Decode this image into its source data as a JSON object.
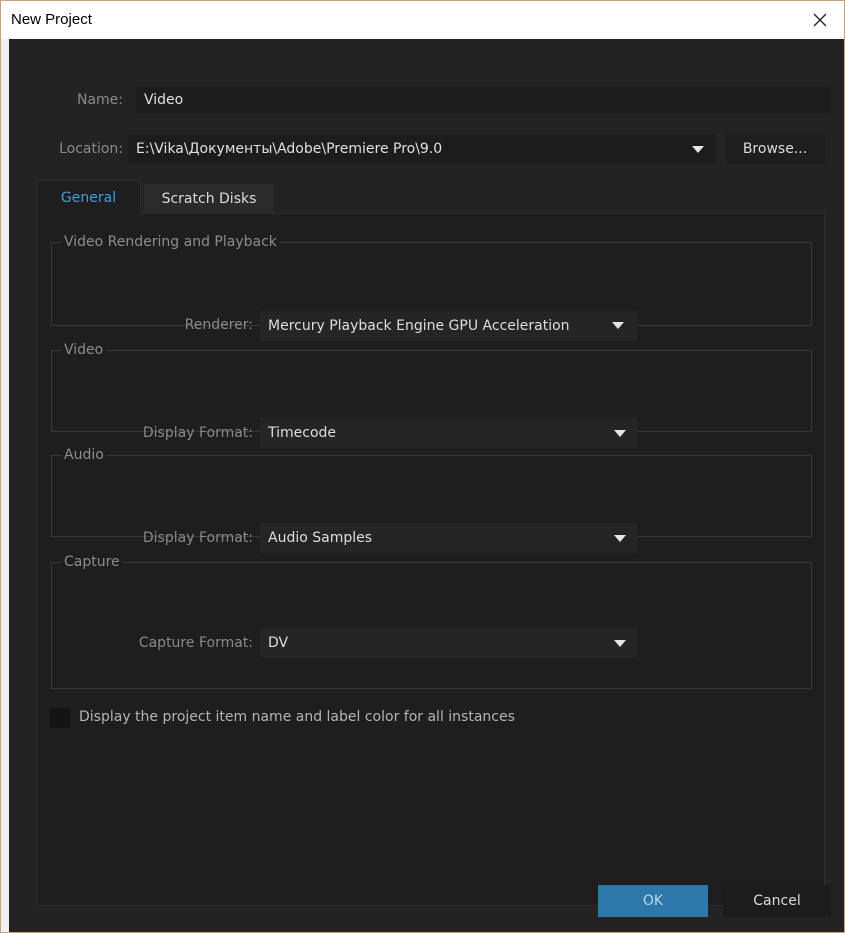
{
  "window": {
    "title": "New Project",
    "close_icon": "close-icon"
  },
  "name_field": {
    "label": "Name:",
    "value": "Video"
  },
  "location_field": {
    "label": "Location:",
    "value": "E:\\Vika\\Документы\\Adobe\\Premiere Pro\\9.0",
    "browse_label": "Browse..."
  },
  "tabs": [
    {
      "label": "General",
      "active": true
    },
    {
      "label": "Scratch Disks",
      "active": false
    }
  ],
  "groups": {
    "rendering": {
      "title": "Video Rendering and Playback",
      "renderer_label": "Renderer:",
      "renderer_value": "Mercury Playback Engine GPU Acceleration"
    },
    "video": {
      "title": "Video",
      "display_format_label": "Display Format:",
      "display_format_value": "Timecode"
    },
    "audio": {
      "title": "Audio",
      "display_format_label": "Display Format:",
      "display_format_value": "Audio Samples"
    },
    "capture": {
      "title": "Capture",
      "capture_format_label": "Capture Format:",
      "capture_format_value": "DV"
    }
  },
  "display_name_checkbox": {
    "label": "Display the project item name and label color for all instances",
    "checked": false
  },
  "buttons": {
    "ok": "OK",
    "cancel": "Cancel"
  },
  "colors": {
    "background": "#232323",
    "field": "#1c1c1c",
    "panel": "#1e1e1e",
    "accent_blue": "#2d77a9",
    "tab_active_text": "#3f9ee2",
    "window_border": "#c9a37a"
  }
}
